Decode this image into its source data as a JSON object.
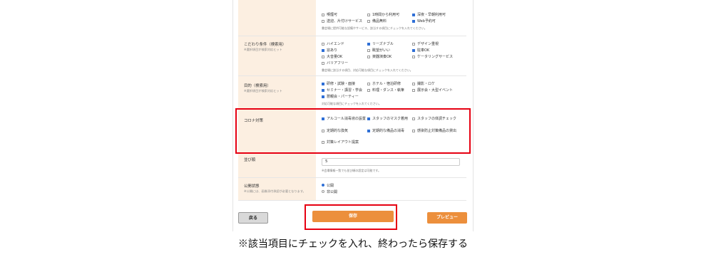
{
  "facilities": {
    "options": [
      {
        "label": "喫煙可",
        "checked": false
      },
      {
        "label": "1時間から利用可",
        "checked": false
      },
      {
        "label": "深夜・早朝利用可",
        "checked": true
      },
      {
        "label": "送迎、片付けサービス",
        "checked": false
      },
      {
        "label": "備品無料",
        "checked": false
      },
      {
        "label": "Web予約可",
        "checked": true
      }
    ],
    "note": "書会場に提供可能な設備やサービス、該当する項目にチェックを入れてください。"
  },
  "kodawari": {
    "title": "こだわり条件（検索用）",
    "sub": "※選択項目が検索対応ヒット",
    "options": [
      {
        "label": "ハイエンド",
        "checked": false
      },
      {
        "label": "リーズナブル",
        "checked": true
      },
      {
        "label": "デザイン重視",
        "checked": false
      },
      {
        "label": "窓あり",
        "checked": true
      },
      {
        "label": "眺望がいい",
        "checked": false
      },
      {
        "label": "駐車OK",
        "checked": true
      },
      {
        "label": "大音量OK",
        "checked": false
      },
      {
        "label": "楽器演奏OK",
        "checked": false
      },
      {
        "label": "ケータリングサービス",
        "checked": false
      },
      {
        "label": "バリアフリー",
        "checked": false
      }
    ],
    "note": "書会場に該当する項目、対応可能な項目にチェックを入れてください。"
  },
  "purpose": {
    "title": "目的（検索用）",
    "sub": "※選択項目が検索対応ヒット",
    "options": [
      {
        "label": "研修・試験・面接",
        "checked": true
      },
      {
        "label": "ホテル・宿泊研修",
        "checked": false
      },
      {
        "label": "撮影・ロケ",
        "checked": false
      },
      {
        "label": "セミナー・講習・学会",
        "checked": true
      },
      {
        "label": "料理・ダンス・執筆",
        "checked": false
      },
      {
        "label": "展示会・大型イベント",
        "checked": false
      },
      {
        "label": "懇親会・パーティー",
        "checked": true
      }
    ],
    "note": "対応可能な項目にチェックを入れてください。"
  },
  "corona": {
    "title": "コロナ対策",
    "options": [
      {
        "label": "アルコール消毒液の設置",
        "checked": true
      },
      {
        "label": "スタッフのマスク着用",
        "checked": true
      },
      {
        "label": "スタッフの体調チェック",
        "checked": false
      },
      {
        "label": "定期的な換気",
        "checked": false
      },
      {
        "label": "定期的な備品の消毒",
        "checked": true
      },
      {
        "label": "感染防止対策備品の貸出",
        "checked": false
      },
      {
        "label": "対策レイアウト提案",
        "checked": false
      }
    ]
  },
  "order": {
    "title": "並び順",
    "value": "5",
    "note": "※会場情報一覧でも並び順の設定は可能です。"
  },
  "publish": {
    "title": "公開状態",
    "sub": "※公開には、画像添付承認が必要となります。",
    "options": [
      {
        "label": "公開",
        "checked": true
      },
      {
        "label": "非公開",
        "checked": false
      }
    ]
  },
  "buttons": {
    "back": "戻る",
    "save": "保存",
    "preview": "プレビュー"
  },
  "colors": {
    "accent_orange": "#ec8f3c",
    "highlight_red": "#e60012",
    "label_bg": "#fcefe1",
    "checkbox_blue": "#2f6fd6"
  },
  "caption": "※該当項目にチェックを入れ、終わったら保存する"
}
